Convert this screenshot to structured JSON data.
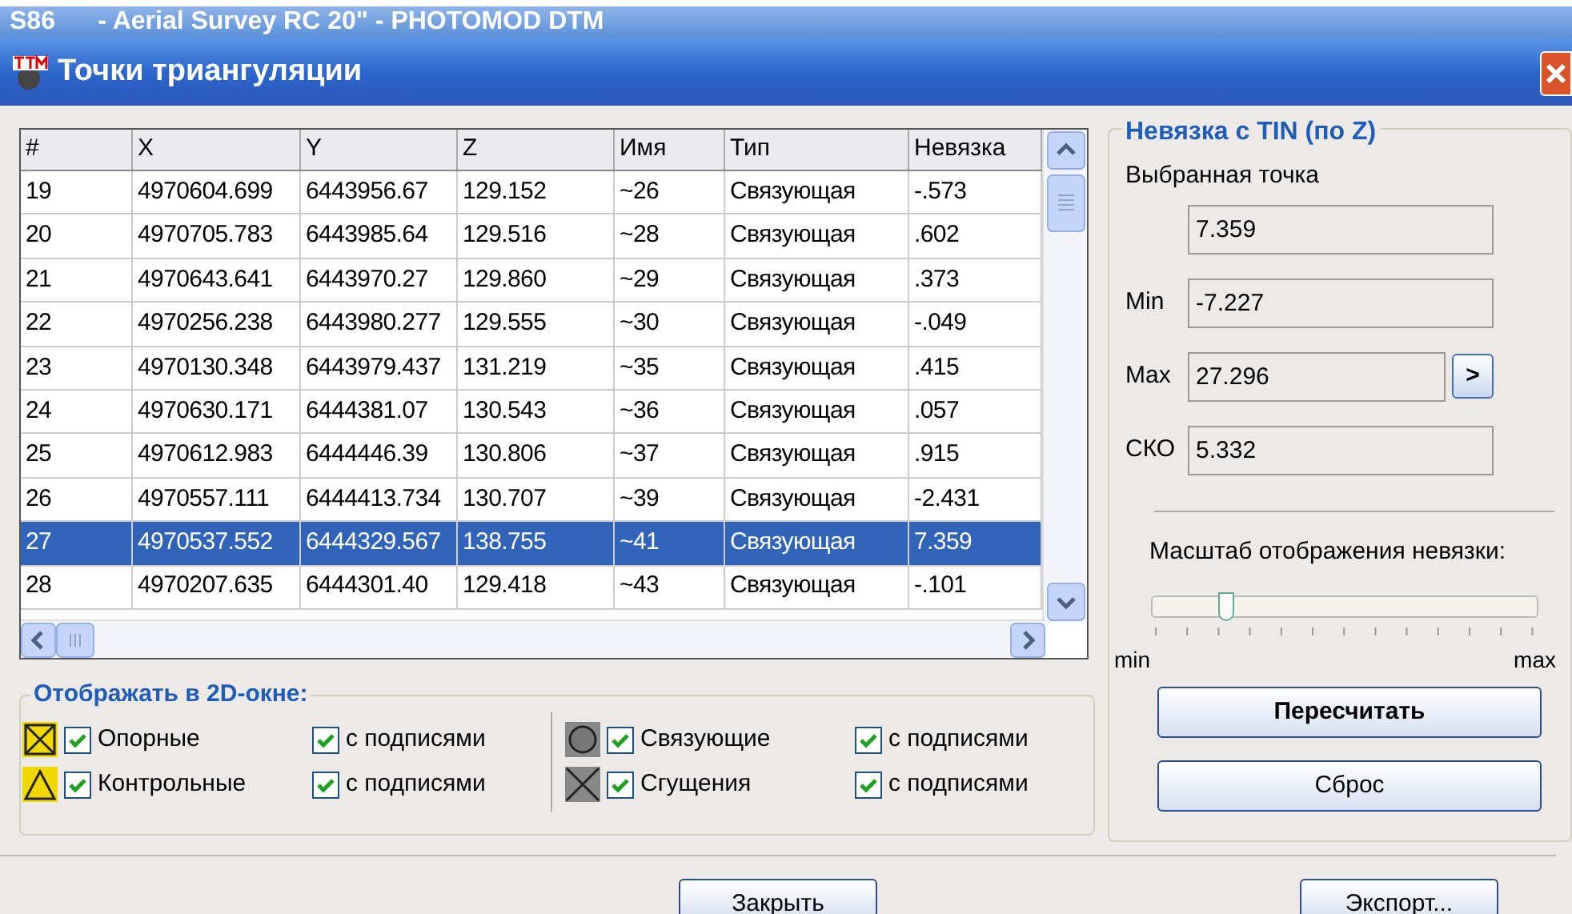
{
  "parent_window": {
    "title": "S86      - Aerial Survey RC 20\" - PHOTOMOD DTM"
  },
  "window": {
    "title": "Точки триангуляции"
  },
  "table": {
    "columns": [
      "#",
      "X",
      "Y",
      "Z",
      "Имя",
      "Тип",
      "Невязка"
    ],
    "rows": [
      {
        "cells": [
          "19",
          "4970604.699",
          "6443956.67",
          "129.152",
          "~26",
          "Связующая",
          "-.573"
        ],
        "selected": false
      },
      {
        "cells": [
          "20",
          "4970705.783",
          "6443985.64",
          "129.516",
          "~28",
          "Связующая",
          ".602"
        ],
        "selected": false
      },
      {
        "cells": [
          "21",
          "4970643.641",
          "6443970.27",
          "129.860",
          "~29",
          "Связующая",
          ".373"
        ],
        "selected": false
      },
      {
        "cells": [
          "22",
          "4970256.238",
          "6443980.277",
          "129.555",
          "~30",
          "Связующая",
          "-.049"
        ],
        "selected": false
      },
      {
        "cells": [
          "23",
          "4970130.348",
          "6443979.437",
          "131.219",
          "~35",
          "Связующая",
          ".415"
        ],
        "selected": false
      },
      {
        "cells": [
          "24",
          "4970630.171",
          "6444381.07",
          "130.543",
          "~36",
          "Связующая",
          ".057"
        ],
        "selected": false
      },
      {
        "cells": [
          "25",
          "4970612.983",
          "6444446.39",
          "130.806",
          "~37",
          "Связующая",
          ".915"
        ],
        "selected": false
      },
      {
        "cells": [
          "26",
          "4970557.111",
          "6444413.734",
          "130.707",
          "~39",
          "Связующая",
          "-2.431"
        ],
        "selected": false
      },
      {
        "cells": [
          "27",
          "4970537.552",
          "6444329.567",
          "138.755",
          "~41",
          "Связующая",
          "7.359"
        ],
        "selected": true
      },
      {
        "cells": [
          "28",
          "4970207.635",
          "6444301.40",
          "129.418",
          "~43",
          "Связующая",
          "-.101"
        ],
        "selected": false
      }
    ]
  },
  "display_group": {
    "title": "Отображать в 2D-окне:",
    "items": [
      {
        "kind": "square",
        "label": "Опорные",
        "checked": true,
        "captions_label": "с подписями",
        "captions_checked": true
      },
      {
        "kind": "triangle",
        "label": "Контрольные",
        "checked": true,
        "captions_label": "с подписями",
        "captions_checked": true
      },
      {
        "kind": "circle",
        "label": "Связующие",
        "checked": true,
        "captions_label": "с подписями",
        "captions_checked": true
      },
      {
        "kind": "cross",
        "label": "Сгущения",
        "checked": true,
        "captions_label": "с подписями",
        "captions_checked": true
      }
    ]
  },
  "tin_group": {
    "title": "Невязка с TIN (по Z)",
    "selected_point_label": "Выбранная точка",
    "selected_point_value": "7.359",
    "fields": [
      {
        "label": "Min",
        "value": "-7.227"
      },
      {
        "label": "Max",
        "value": "27.296",
        "button": ">"
      },
      {
        "label": "СКО",
        "value": "5.332"
      }
    ],
    "scale_label": "Масштаб отображения невязки:",
    "scale": {
      "level": 0.19,
      "min_label": "min",
      "max_label": "max"
    },
    "buttons": [
      "Пересчитать",
      "Сброс"
    ]
  },
  "footer_buttons": [
    "Закрыть",
    "Экспорт..."
  ]
}
